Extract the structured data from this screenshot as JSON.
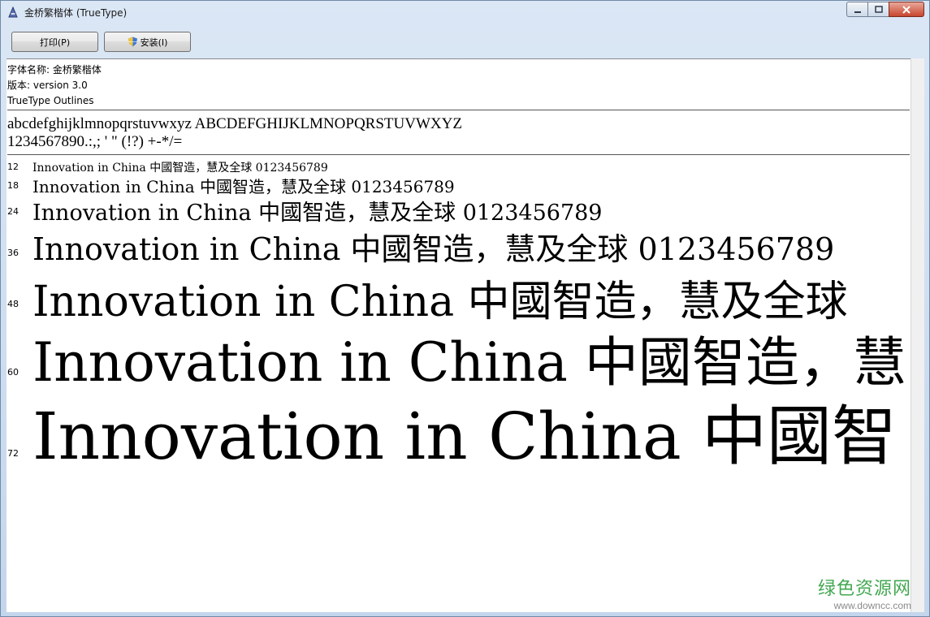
{
  "window": {
    "title": "金桥繁楷体 (TrueType)",
    "caption_buttons": [
      "minimize",
      "maximize",
      "close"
    ]
  },
  "toolbar": {
    "print_label": "打印(P)",
    "install_label": "安装(I)"
  },
  "font_info": {
    "name_line": "字体名称: 金桥繁楷体",
    "version_line": "版本: version 3.0",
    "type_line": "TrueType Outlines"
  },
  "charset": {
    "line1": "abcdefghijklmnopqrstuvwxyz ABCDEFGHIJKLMNOPQRSTUVWXYZ",
    "line2": "1234567890.:,; ' \" (!?) +-*/="
  },
  "samples": [
    {
      "size": "12",
      "text": "Innovation in China 中國智造，慧及全球 0123456789"
    },
    {
      "size": "18",
      "text": "Innovation in China 中國智造，慧及全球 0123456789"
    },
    {
      "size": "24",
      "text": "Innovation in China 中國智造，慧及全球 0123456789"
    },
    {
      "size": "36",
      "text": "Innovation in China 中國智造，慧及全球 0123456789"
    },
    {
      "size": "48",
      "text": "Innovation in China 中國智造，慧及全球"
    },
    {
      "size": "60",
      "text": "Innovation in China 中國智造，慧"
    },
    {
      "size": "72",
      "text": "Innovation in China 中國智"
    }
  ],
  "watermark": {
    "cn": "绿色资源网",
    "url": "www.downcc.com"
  },
  "colors": {
    "watermark_green": "#2e9e3f",
    "close_button": "#c7452e"
  }
}
